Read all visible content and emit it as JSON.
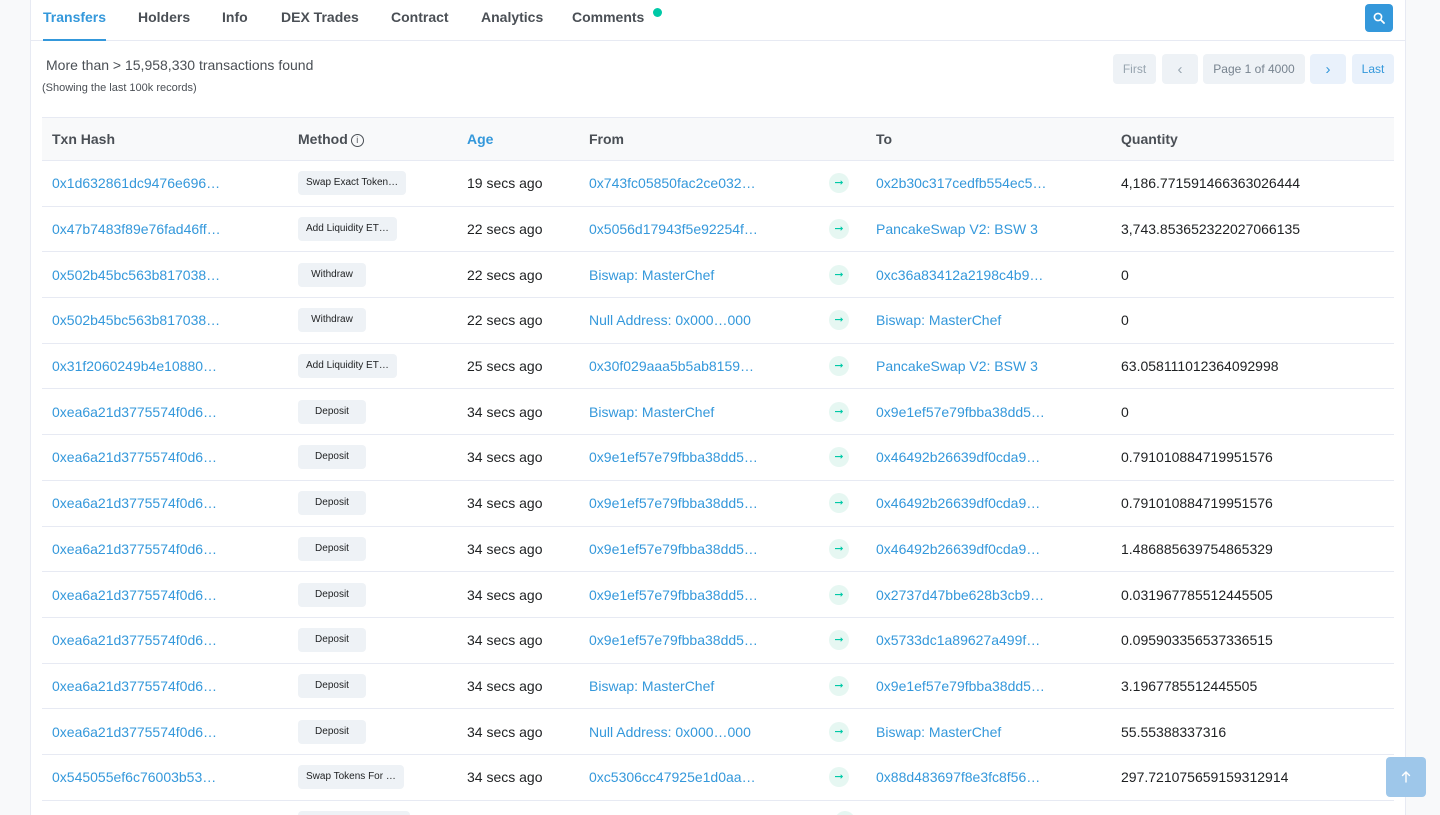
{
  "tabs": [
    "Transfers",
    "Holders",
    "Info",
    "DEX Trades",
    "Contract",
    "Analytics",
    "Comments"
  ],
  "summary": "More than > 15,958,330 transactions found",
  "subsummary": "(Showing the last 100k records)",
  "pager": {
    "first": "First",
    "prev": "‹",
    "info": "Page 1 of 4000",
    "next": "›",
    "last": "Last"
  },
  "columns": {
    "hash": "Txn Hash",
    "method": "Method",
    "age": "Age",
    "from": "From",
    "to": "To",
    "quantity": "Quantity"
  },
  "icons": {
    "search": "search-icon",
    "info": "info-icon",
    "arrow": "arrow-right-icon",
    "totop": "arrow-up-icon"
  },
  "colors": {
    "link": "#3498db",
    "accent": "#00c9a7"
  },
  "rows": [
    {
      "hash": "0x1d632861dc9476e696…",
      "method": "Swap Exact Token…",
      "age": "19 secs ago",
      "from": "0x743fc05850fac2ce032…",
      "to": "0x2b30c317cedfb554ec5…",
      "qty": "4,186.771591466363026444"
    },
    {
      "hash": "0x47b7483f89e76fad46ff…",
      "method": "Add Liquidity ET…",
      "age": "22 secs ago",
      "from": "0x5056d17943f5e92254f…",
      "to": "PancakeSwap V2: BSW 3",
      "qty": "3,743.853652322027066135"
    },
    {
      "hash": "0x502b45bc563b817038…",
      "method": "Withdraw",
      "age": "22 secs ago",
      "from": "Biswap: MasterChef",
      "to": "0xc36a83412a2198c4b9…",
      "qty": "0"
    },
    {
      "hash": "0x502b45bc563b817038…",
      "method": "Withdraw",
      "age": "22 secs ago",
      "from": "Null Address: 0x000…000",
      "to": "Biswap: MasterChef",
      "qty": "0"
    },
    {
      "hash": "0x31f2060249b4e10880…",
      "method": "Add Liquidity ET…",
      "age": "25 secs ago",
      "from": "0x30f029aaa5b5ab8159…",
      "to": "PancakeSwap V2: BSW 3",
      "qty": "63.058111012364092998"
    },
    {
      "hash": "0xea6a21d3775574f0d6…",
      "method": "Deposit",
      "age": "34 secs ago",
      "from": "Biswap: MasterChef",
      "to": "0x9e1ef57e79fbba38dd5…",
      "qty": "0"
    },
    {
      "hash": "0xea6a21d3775574f0d6…",
      "method": "Deposit",
      "age": "34 secs ago",
      "from": "0x9e1ef57e79fbba38dd5…",
      "to": "0x46492b26639df0cda9…",
      "qty": "0.791010884719951576"
    },
    {
      "hash": "0xea6a21d3775574f0d6…",
      "method": "Deposit",
      "age": "34 secs ago",
      "from": "0x9e1ef57e79fbba38dd5…",
      "to": "0x46492b26639df0cda9…",
      "qty": "0.791010884719951576"
    },
    {
      "hash": "0xea6a21d3775574f0d6…",
      "method": "Deposit",
      "age": "34 secs ago",
      "from": "0x9e1ef57e79fbba38dd5…",
      "to": "0x46492b26639df0cda9…",
      "qty": "1.486885639754865329"
    },
    {
      "hash": "0xea6a21d3775574f0d6…",
      "method": "Deposit",
      "age": "34 secs ago",
      "from": "0x9e1ef57e79fbba38dd5…",
      "to": "0x2737d47bbe628b3cb9…",
      "qty": "0.031967785512445505"
    },
    {
      "hash": "0xea6a21d3775574f0d6…",
      "method": "Deposit",
      "age": "34 secs ago",
      "from": "0x9e1ef57e79fbba38dd5…",
      "to": "0x5733dc1a89627a499f…",
      "qty": "0.095903356537336515"
    },
    {
      "hash": "0xea6a21d3775574f0d6…",
      "method": "Deposit",
      "age": "34 secs ago",
      "from": "Biswap: MasterChef",
      "to": "0x9e1ef57e79fbba38dd5…",
      "qty": "3.1967785512445505"
    },
    {
      "hash": "0xea6a21d3775574f0d6…",
      "method": "Deposit",
      "age": "34 secs ago",
      "from": "Null Address: 0x000…000",
      "to": "Biswap: MasterChef",
      "qty": "55.55388337316"
    },
    {
      "hash": "0x545055ef6c76003b53…",
      "method": "Swap Tokens For …",
      "age": "34 secs ago",
      "from": "0xc5306cc47925e1d0aa…",
      "to": "0x88d483697f8e3fc8f56…",
      "qty": "297.721075659159312914"
    }
  ]
}
